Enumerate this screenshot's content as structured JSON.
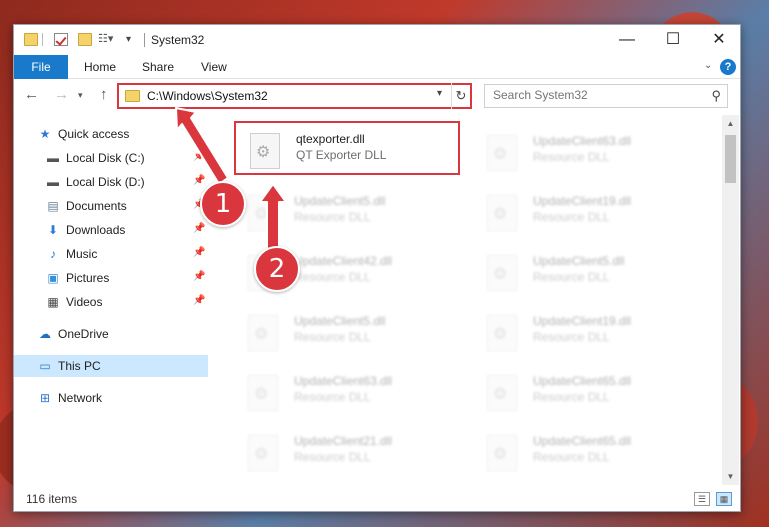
{
  "window": {
    "title": "System32"
  },
  "ribbon": {
    "file": "File",
    "home": "Home",
    "share": "Share",
    "view": "View",
    "help": "?"
  },
  "address": {
    "path": "C:\\Windows\\System32"
  },
  "search": {
    "placeholder": "Search System32"
  },
  "sidebar": {
    "items": [
      {
        "label": "Quick access",
        "icon": "star-icon"
      },
      {
        "label": "Local Disk (C:)",
        "icon": "drive-icon",
        "pinned": true
      },
      {
        "label": "Local Disk (D:)",
        "icon": "drive-icon",
        "pinned": true
      },
      {
        "label": "Documents",
        "icon": "documents-icon",
        "pinned": true
      },
      {
        "label": "Downloads",
        "icon": "downloads-icon",
        "pinned": true
      },
      {
        "label": "Music",
        "icon": "music-icon",
        "pinned": true
      },
      {
        "label": "Pictures",
        "icon": "pictures-icon",
        "pinned": true
      },
      {
        "label": "Videos",
        "icon": "videos-icon",
        "pinned": true
      },
      {
        "label": "OneDrive",
        "icon": "onedrive-icon"
      },
      {
        "label": "This PC",
        "icon": "this-pc-icon",
        "selected": true
      },
      {
        "label": "Network",
        "icon": "network-icon"
      }
    ]
  },
  "files": {
    "highlighted": {
      "name": "qtexporter.dll",
      "desc": "QT Exporter DLL"
    },
    "col1": [
      {
        "name": "UpdateClient5.dll",
        "desc": "Resource DLL"
      },
      {
        "name": "UpdateClient42.dll",
        "desc": "Resource DLL"
      },
      {
        "name": "UpdateClient5.dll",
        "desc": "Resource DLL"
      },
      {
        "name": "UpdateClient63.dll",
        "desc": "Resource DLL"
      },
      {
        "name": "UpdateClient21.dll",
        "desc": "Resource DLL"
      }
    ],
    "col2": [
      {
        "name": "UpdateClient63.dll",
        "desc": "Resource DLL"
      },
      {
        "name": "UpdateClient19.dll",
        "desc": "Resource DLL"
      },
      {
        "name": "UpdateClient5.dll",
        "desc": "Resource DLL"
      },
      {
        "name": "UpdateClient19.dll",
        "desc": "Resource DLL"
      },
      {
        "name": "UpdateClient65.dll",
        "desc": "Resource DLL"
      },
      {
        "name": "UpdateClient65.dll",
        "desc": "Resource DLL"
      }
    ]
  },
  "status": {
    "count": "116 items"
  },
  "annotations": {
    "step1": "1",
    "step2": "2"
  },
  "colors": {
    "highlight": "#d9363e",
    "accent": "#1979ca"
  }
}
